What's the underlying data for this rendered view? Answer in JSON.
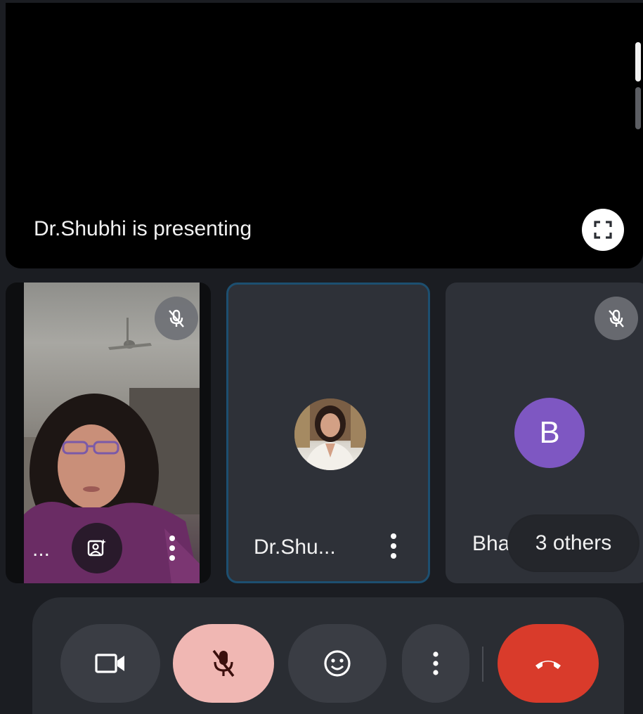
{
  "presentation": {
    "status_text": "Dr.Shubhi is presenting",
    "fullscreen_icon": "fullscreen-icon"
  },
  "tiles": {
    "self": {
      "name_label": "...",
      "muted": true,
      "effects_icon": "portrait-effects-icon"
    },
    "dr_shubhi": {
      "name_label": "Dr.Shu...",
      "active_speaker": true
    },
    "b": {
      "avatar_letter": "B",
      "name_label": "Bha",
      "muted": true,
      "avatar_color": "#7e57c2"
    },
    "others_pill": "3 others"
  },
  "controls": {
    "camera": {
      "icon": "video-camera-icon"
    },
    "mic": {
      "icon": "mic-off-icon",
      "muted": true
    },
    "reactions": {
      "icon": "emoji-icon"
    },
    "more": {
      "icon": "more-vert-icon"
    },
    "end_call": {
      "icon": "call-end-icon",
      "color": "#d93b2b"
    }
  }
}
